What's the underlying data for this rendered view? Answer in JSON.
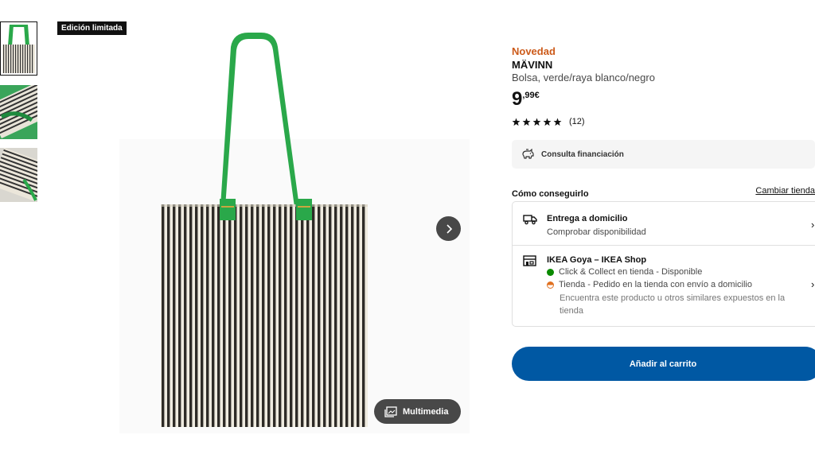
{
  "badge": "Edición limitada",
  "thumbnails": [
    "bolsa-frontal",
    "bolsa-detalle",
    "bolsa-doblada"
  ],
  "gallery": {
    "multimedia_label": "Multimedia"
  },
  "product": {
    "tag": "Novedad",
    "name": "MÄVINN",
    "description": "Bolsa, verde/raya blanco/negro",
    "price_int": "9",
    "price_dec": ",99€",
    "rating": 5,
    "reviews": "(12)"
  },
  "financing": {
    "label": "Consulta financiación",
    "icon": "piggy-bank-icon"
  },
  "availability": {
    "title": "Cómo conseguirlo",
    "change_link": "Cambiar tienda",
    "delivery": {
      "title": "Entrega a domicilio",
      "subtitle": "Comprobar disponibilidad",
      "icon": "truck-icon"
    },
    "store": {
      "title": "IKEA Goya – IKEA Shop",
      "click_collect": "Click & Collect en tienda - Disponible",
      "store_order": "Tienda - Pedido en la tienda con envío a domicilio",
      "note": "Encuentra este producto u otros similares expuestos en la tienda",
      "icon": "store-icon"
    }
  },
  "cart": {
    "label": "Añadir al carrito"
  },
  "colors": {
    "novedad": "#cc5a1a",
    "cart": "#0058a3",
    "strap": "#2aa84a",
    "available": "#0a8a00",
    "partial": "#e07020"
  }
}
